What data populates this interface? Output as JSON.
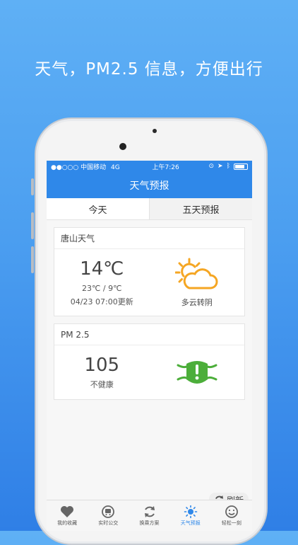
{
  "promo": {
    "headline": "天气，PM2.5 信息，方便出行"
  },
  "status_bar": {
    "carrier": "●●○○○ 中国移动",
    "network": "4G",
    "time": "上午7:26"
  },
  "nav": {
    "title": "天气预报"
  },
  "tabs": [
    {
      "label": "今天",
      "selected": true
    },
    {
      "label": "五天预报",
      "selected": false
    }
  ],
  "weather_card": {
    "title": "唐山天气",
    "temperature": "14℃",
    "range": "23℃ / 9℃",
    "updated": "04/23 07:00更新",
    "condition": "多云转阴",
    "icon": "partly-cloudy-icon"
  },
  "pm_card": {
    "title": "PM 2.5",
    "value": "105",
    "status": "不健康",
    "icon": "mask-warning-icon"
  },
  "refresh_button": {
    "label": "刷新"
  },
  "bottom_nav": [
    {
      "label": "我的收藏",
      "icon": "heart-icon",
      "active": false
    },
    {
      "label": "实时公交",
      "icon": "bus-icon",
      "active": false
    },
    {
      "label": "换乘方案",
      "icon": "refresh-icon",
      "active": false
    },
    {
      "label": "天气预报",
      "icon": "sun-icon",
      "active": true
    },
    {
      "label": "轻松一刻",
      "icon": "smile-icon",
      "active": false
    }
  ],
  "colors": {
    "primary": "#2f88e9",
    "sun": "#f5a623",
    "mask": "#4cae3a"
  }
}
